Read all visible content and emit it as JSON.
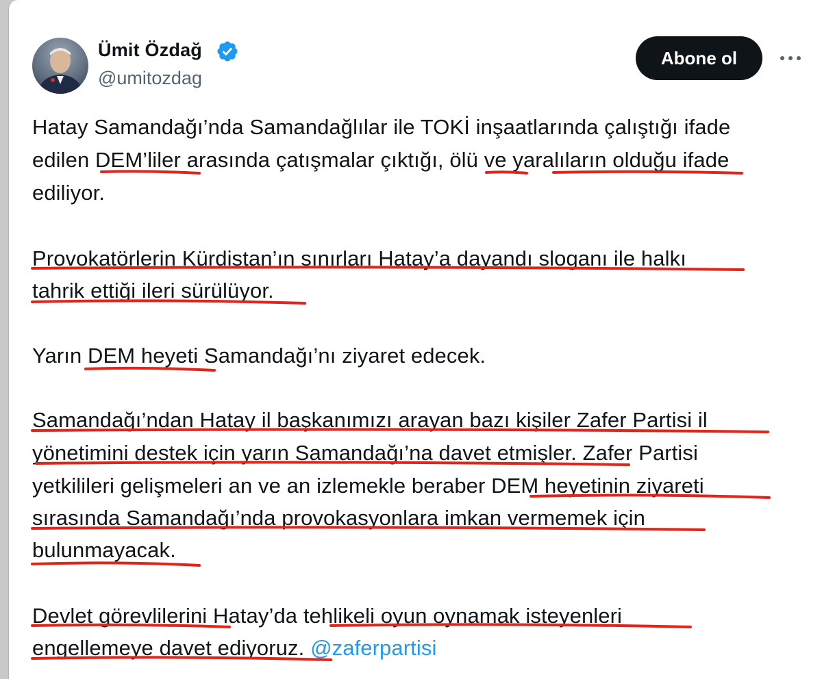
{
  "author": {
    "name": "Ümit Özdağ",
    "handle": "@umitozdag"
  },
  "actions": {
    "follow_label": "Abone ol"
  },
  "tweet": {
    "lines": [
      "Hatay Samandağı’nda Samandağlılar ile TOKİ inşaatlarında çalıştığı ifade",
      "edilen DEM’liler arasında çatışmalar çıktığı, ölü ve yaralıların olduğu ifade",
      "ediliyor.",
      "Provokatörlerin Kürdistan’ın sınırları Hatay’a dayandı sloganı ile halkı",
      "tahrik ettiği ileri sürülüyor.",
      "Yarın DEM heyeti Samandağı’nı ziyaret edecek.",
      "Samandağı’ndan Hatay il başkanımızı arayan bazı kişiler Zafer Partisi il",
      "yönetimini destek için yarın Samandağı’na davet etmişler. Zafer Partisi",
      "yetkilileri gelişmeleri an ve an izlemekle beraber DEM heyetinin ziyareti",
      "sırasında Samandağı’nda provokasyonlara imkan vermemek için",
      "bulunmayacak.",
      "Devlet görevlilerini Hatay’da tehlikeli oyun oynamak isteyenleri",
      "engellemeye davet ediyoruz."
    ],
    "mention": "@zaferpartisi"
  },
  "colors": {
    "text": "#0f1419",
    "secondary": "#536471",
    "link": "#1d9bf0",
    "verified": "#1d9bf0",
    "follow_bg": "#0f1419",
    "underline": "#e3241b"
  },
  "icons": {
    "verified": "verified-badge-icon",
    "more": "more-horizontal-icon"
  }
}
